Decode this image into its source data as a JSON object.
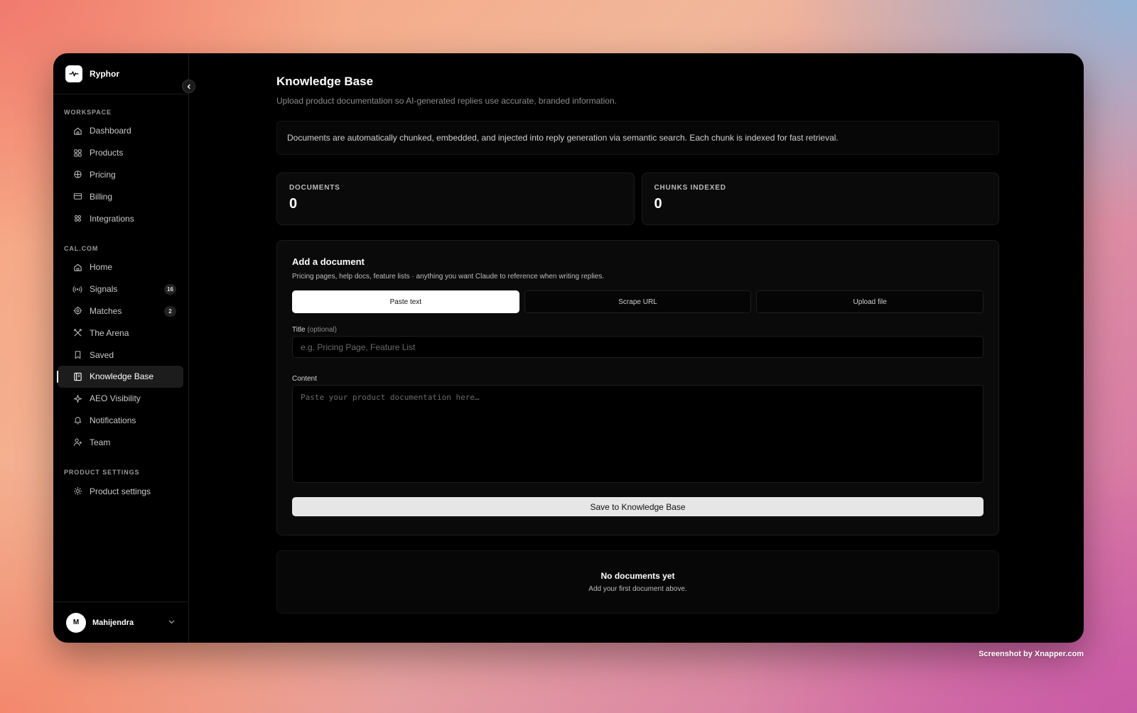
{
  "app": {
    "name": "Ryphor"
  },
  "sidebar": {
    "sections": {
      "workspace": "WORKSPACE",
      "calcom": "CAL.COM",
      "product_settings": "PRODUCT SETTINGS"
    },
    "workspace_items": [
      {
        "label": "Dashboard",
        "icon": "home-icon"
      },
      {
        "label": "Products",
        "icon": "grid-icon"
      },
      {
        "label": "Pricing",
        "icon": "globe-icon"
      },
      {
        "label": "Billing",
        "icon": "card-icon"
      },
      {
        "label": "Integrations",
        "icon": "integrations-icon"
      }
    ],
    "calcom_items": [
      {
        "label": "Home",
        "icon": "home-icon"
      },
      {
        "label": "Signals",
        "icon": "signal-icon",
        "badge": "16"
      },
      {
        "label": "Matches",
        "icon": "target-icon",
        "badge": "2"
      },
      {
        "label": "The Arena",
        "icon": "arena-icon"
      },
      {
        "label": "Saved",
        "icon": "bookmark-icon"
      },
      {
        "label": "Knowledge Base",
        "icon": "book-icon",
        "active": true
      },
      {
        "label": "AEO Visibility",
        "icon": "sparkle-icon"
      },
      {
        "label": "Notifications",
        "icon": "bell-icon"
      },
      {
        "label": "Team",
        "icon": "user-plus-icon"
      }
    ],
    "settings_items": [
      {
        "label": "Product settings",
        "icon": "sun-gear-icon"
      }
    ],
    "user": {
      "initial": "M",
      "name": "Mahijendra"
    }
  },
  "page": {
    "title": "Knowledge Base",
    "subtitle": "Upload product documentation so AI-generated replies use accurate, branded information.",
    "info": "Documents are automatically chunked, embedded, and injected into reply generation via semantic search. Each chunk is indexed for fast retrieval."
  },
  "stats": {
    "documents": {
      "label": "DOCUMENTS",
      "value": "0"
    },
    "chunks": {
      "label": "CHUNKS INDEXED",
      "value": "0"
    }
  },
  "add_document": {
    "title": "Add a document",
    "subtitle": "Pricing pages, help docs, feature lists · anything you want Claude to reference when writing replies.",
    "tabs": [
      "Paste text",
      "Scrape URL",
      "Upload file"
    ],
    "active_tab": "Paste text",
    "title_label": "Title",
    "title_optional": "(optional)",
    "title_placeholder": "e.g. Pricing Page, Feature List",
    "content_label": "Content",
    "content_placeholder": "Paste your product documentation here…",
    "save_label": "Save to Knowledge Base"
  },
  "empty_state": {
    "title": "No documents yet",
    "subtitle": "Add your first document above."
  },
  "watermark": "Screenshot by Xnapper.com"
}
